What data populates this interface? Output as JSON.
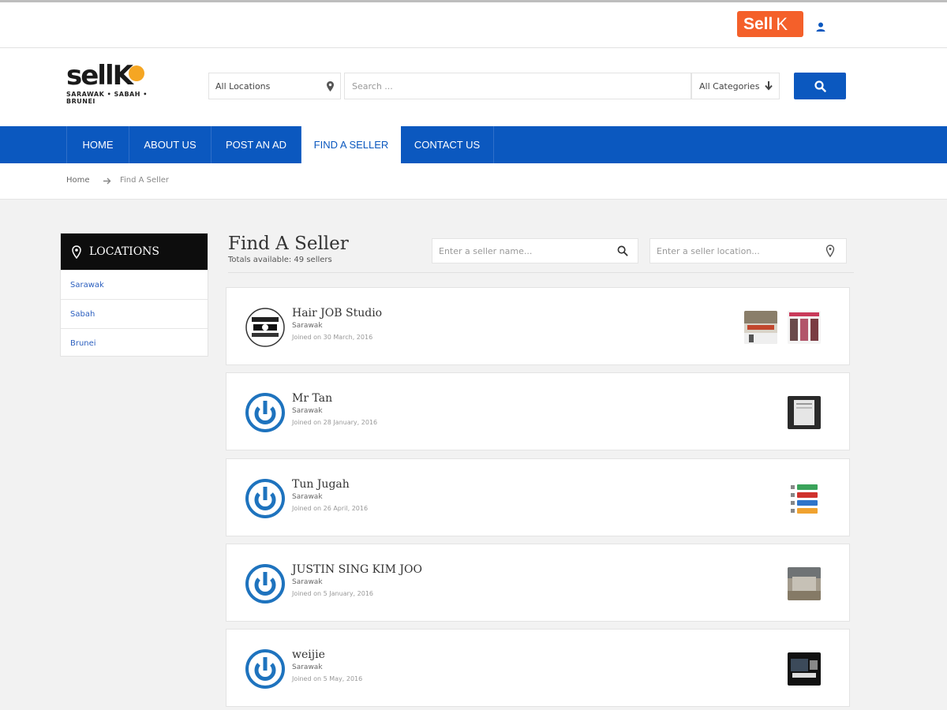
{
  "topbar": {
    "sell_text": "Sell",
    "sell_k": "K"
  },
  "logo": {
    "word": "sellK",
    "tagline": "SARAWAK • SABAH • BRUNEI"
  },
  "search": {
    "location_label": "All Locations",
    "placeholder": "Search ...",
    "category_label": "All Categories"
  },
  "nav": {
    "items": [
      {
        "label": "HOME"
      },
      {
        "label": "ABOUT US"
      },
      {
        "label": "POST AN AD"
      },
      {
        "label": "FIND A SELLER"
      },
      {
        "label": "CONTACT US"
      }
    ],
    "active": "FIND A SELLER"
  },
  "breadcrumb": {
    "home": "Home",
    "current": "Find A Seller"
  },
  "locations": {
    "title": "LOCATIONS",
    "items": [
      {
        "label": "Sarawak"
      },
      {
        "label": "Sabah"
      },
      {
        "label": "Brunei"
      }
    ]
  },
  "main": {
    "title": "Find A Seller",
    "subtitle": "Totals available: 49 sellers",
    "seller_name_placeholder": "Enter a seller name...",
    "seller_location_placeholder": "Enter a seller location..."
  },
  "sellers": [
    {
      "name": "Hair JOB Studio",
      "location": "Sarawak",
      "joined": "Joined on 30 March, 2016",
      "avatar": "logo"
    },
    {
      "name": "Mr Tan",
      "location": "Sarawak",
      "joined": "Joined on 28 January, 2016",
      "avatar": "default"
    },
    {
      "name": "Tun Jugah",
      "location": "Sarawak",
      "joined": "Joined on 26 April, 2016",
      "avatar": "default"
    },
    {
      "name": "JUSTIN SING KIM JOO",
      "location": "Sarawak",
      "joined": "Joined on 5 January, 2016",
      "avatar": "default"
    },
    {
      "name": "weijie",
      "location": "Sarawak",
      "joined": "Joined on 5 May, 2016",
      "avatar": "default"
    }
  ],
  "colors": {
    "brand_blue": "#0b58bf",
    "sell_orange": "#f4602a",
    "dark_header": "#0d0d0d"
  }
}
